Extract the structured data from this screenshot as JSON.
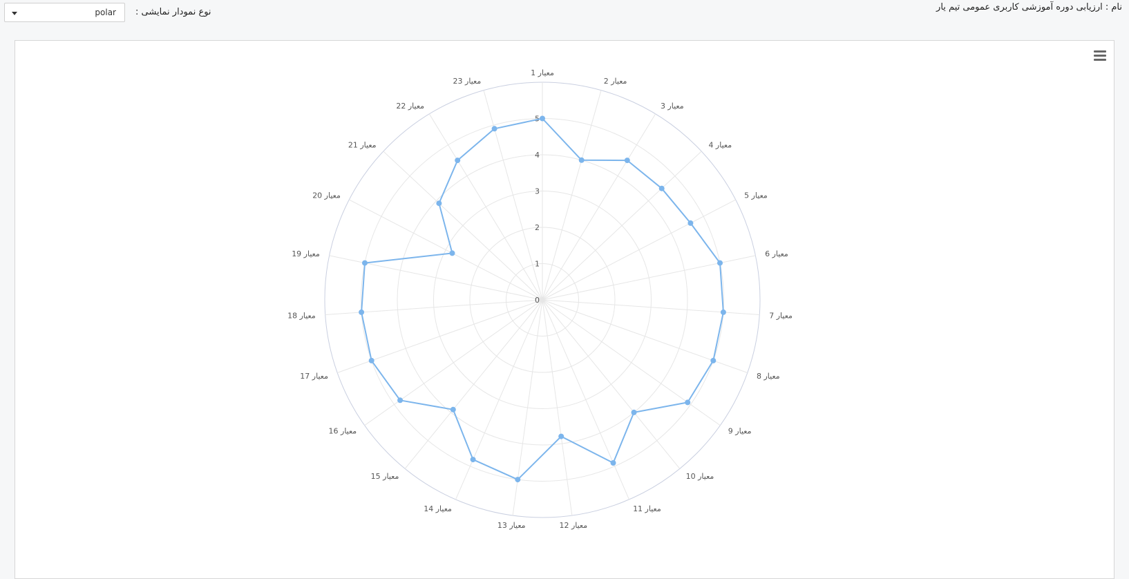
{
  "header": {
    "title": "نام : ارزیابی دوره آموزشی کاربری عمومی تیم یار",
    "chart_type_label": "نوع نمودار نمایشی :",
    "chart_type_value": "polar"
  },
  "icons": {
    "chart_menu": "hamburger-menu-icon"
  },
  "colors": {
    "series": "#7cb5ec",
    "grid": "#e6e6e6",
    "outer": "#c9cfe0"
  },
  "chart_data": {
    "type": "polar",
    "title": "",
    "categories": [
      "معیار 1",
      "معیار 2",
      "معیار 3",
      "معیار 4",
      "معیار 5",
      "معیار 6",
      "معیار 7",
      "معیار 8",
      "معیار 9",
      "معیار 10",
      "معیار 11",
      "معیار 12",
      "معیار 13",
      "معیار 14",
      "معیار 15",
      "معیار 16",
      "معیار 17",
      "معیار 18",
      "معیار 19",
      "معیار 20",
      "معیار 21",
      "معیار 22",
      "معیار 23"
    ],
    "series": [
      {
        "values": [
          5,
          4,
          4.5,
          4.5,
          4.6,
          5,
          5,
          5,
          4.9,
          4,
          4.9,
          3.8,
          5,
          4.8,
          3.9,
          4.8,
          5,
          5,
          5,
          2.8,
          3.9,
          4.5,
          4.9
        ]
      }
    ],
    "ylim": [
      0,
      5
    ],
    "yticks": [
      0,
      1,
      2,
      3,
      4,
      5
    ],
    "grid": true,
    "legend": "none"
  }
}
